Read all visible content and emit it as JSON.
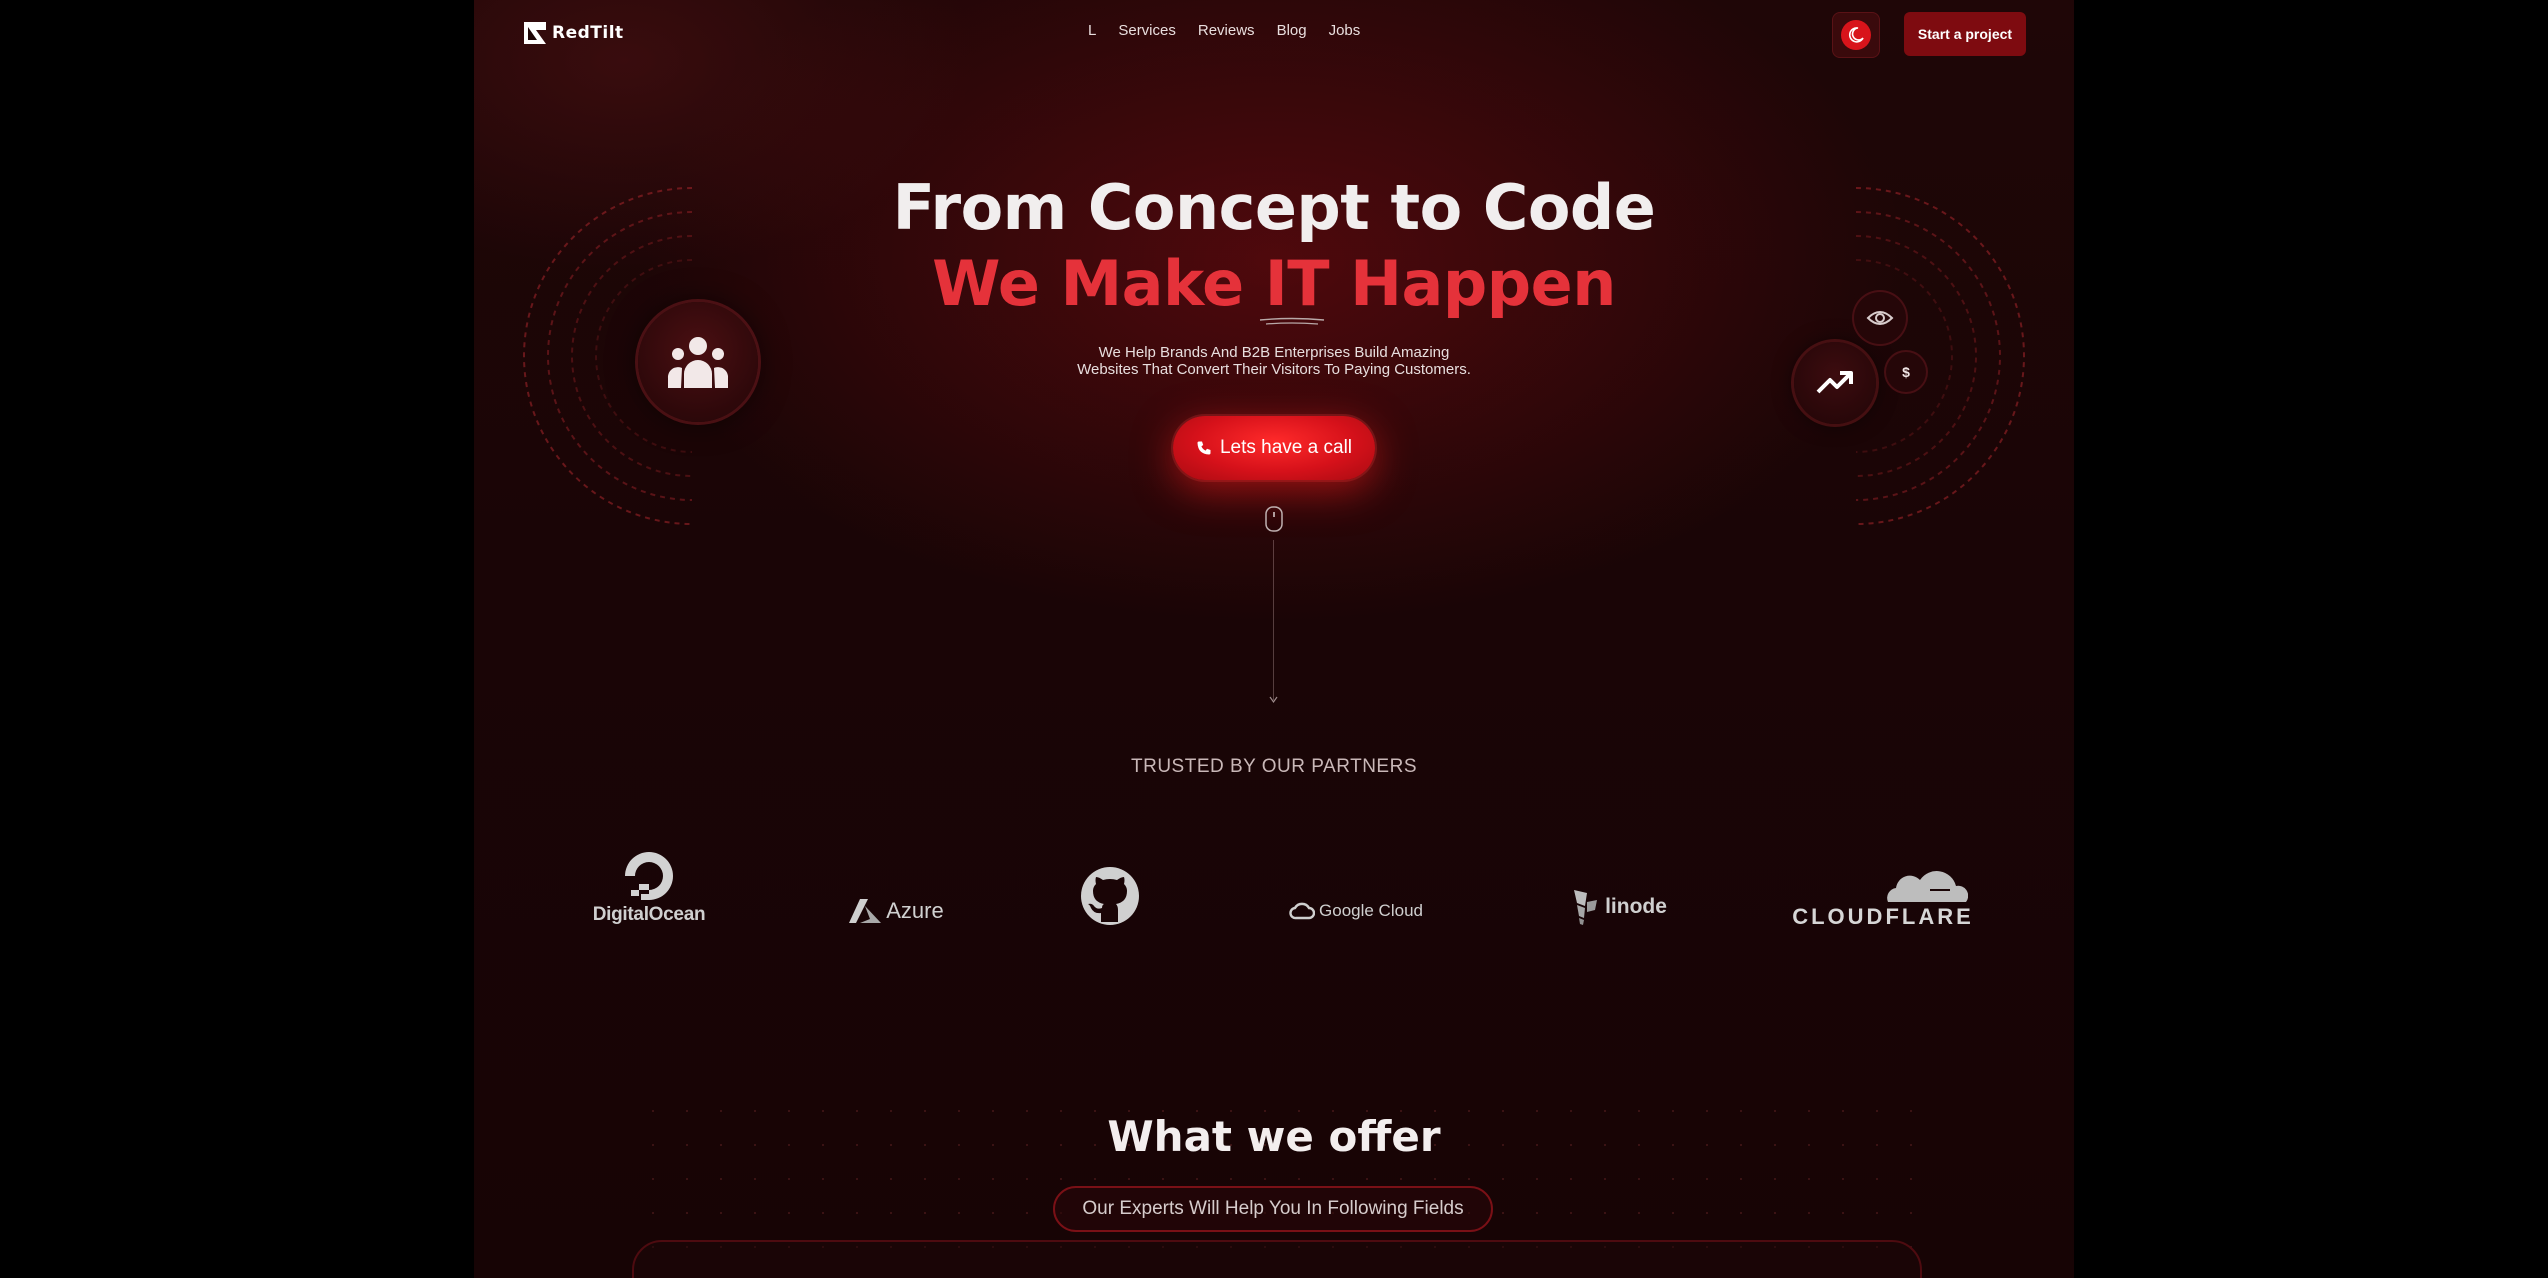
{
  "header": {
    "logo_text": "RedTilt",
    "nav": [
      "L",
      "Services",
      "Reviews",
      "Blog",
      "Jobs"
    ],
    "theme_toggle_icon": "moon-icon",
    "cta_label": "Start a project"
  },
  "hero": {
    "title": "From Concept to Code",
    "subtitle": "We Make IT Happen",
    "description_line1": "We Help Brands And B2B Enterprises Build Amazing",
    "description_line2": "Websites That Convert Their Visitors To Paying Customers.",
    "call_button": "Lets have a call",
    "call_icon": "phone-icon",
    "dollar_label": "$"
  },
  "partners": {
    "heading": "TRUSTED BY OUR PARTNERS",
    "items": [
      {
        "name": "DigitalOcean"
      },
      {
        "name": "Azure"
      },
      {
        "name": "GitHub",
        "icon": "github-icon"
      },
      {
        "name": "Google Cloud"
      },
      {
        "name": "linode"
      },
      {
        "name": "CLOUDFLARE"
      }
    ]
  },
  "offer": {
    "title": "What we offer",
    "pill": "Our Experts Will Help You In Following Fields"
  },
  "colors": {
    "accent": "#e5323a",
    "button_red": "#d6111a",
    "cta_dark_red": "#7e0b10",
    "background": "#1a0506"
  }
}
